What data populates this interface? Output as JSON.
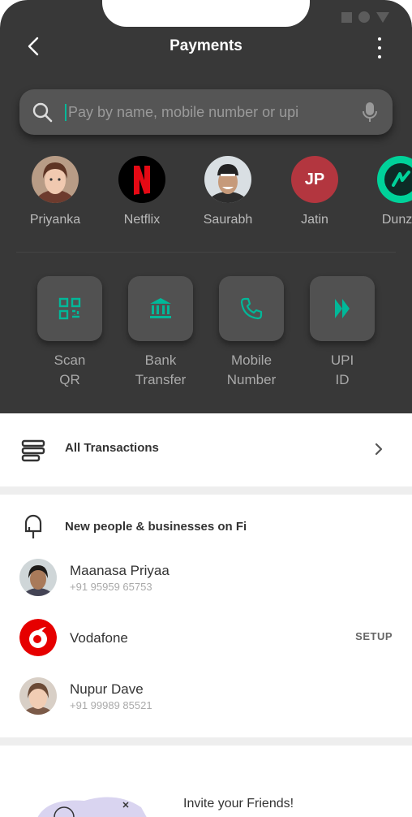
{
  "header": {
    "title": "Payments"
  },
  "search": {
    "placeholder": "Pay by name, mobile number or upi"
  },
  "contacts": [
    {
      "name": "Priyanka"
    },
    {
      "name": "Netflix"
    },
    {
      "name": "Saurabh"
    },
    {
      "name": "Jatin",
      "initials": "JP"
    },
    {
      "name": "Dunzo"
    }
  ],
  "actions": [
    {
      "label": "Scan\nQR"
    },
    {
      "label": "Bank\nTransfer"
    },
    {
      "label": "Mobile\nNumber"
    },
    {
      "label": "UPI\nID"
    }
  ],
  "all_transactions": {
    "label": "All Transactions"
  },
  "new_people": {
    "title": "New people & businesses on Fi",
    "people": [
      {
        "name": "Maanasa Priyaa",
        "phone": "+91 95959 65753"
      },
      {
        "name": "Vodafone",
        "action": "SETUP"
      },
      {
        "name": "Nupur Dave",
        "phone": "+91 99989 85521"
      }
    ]
  },
  "invite": {
    "text": "Invite your Friends!"
  },
  "colors": {
    "dark_bg": "#383838",
    "accent": "#00b899",
    "vodafone_red": "#e60000",
    "netflix_red": "#e50914"
  }
}
